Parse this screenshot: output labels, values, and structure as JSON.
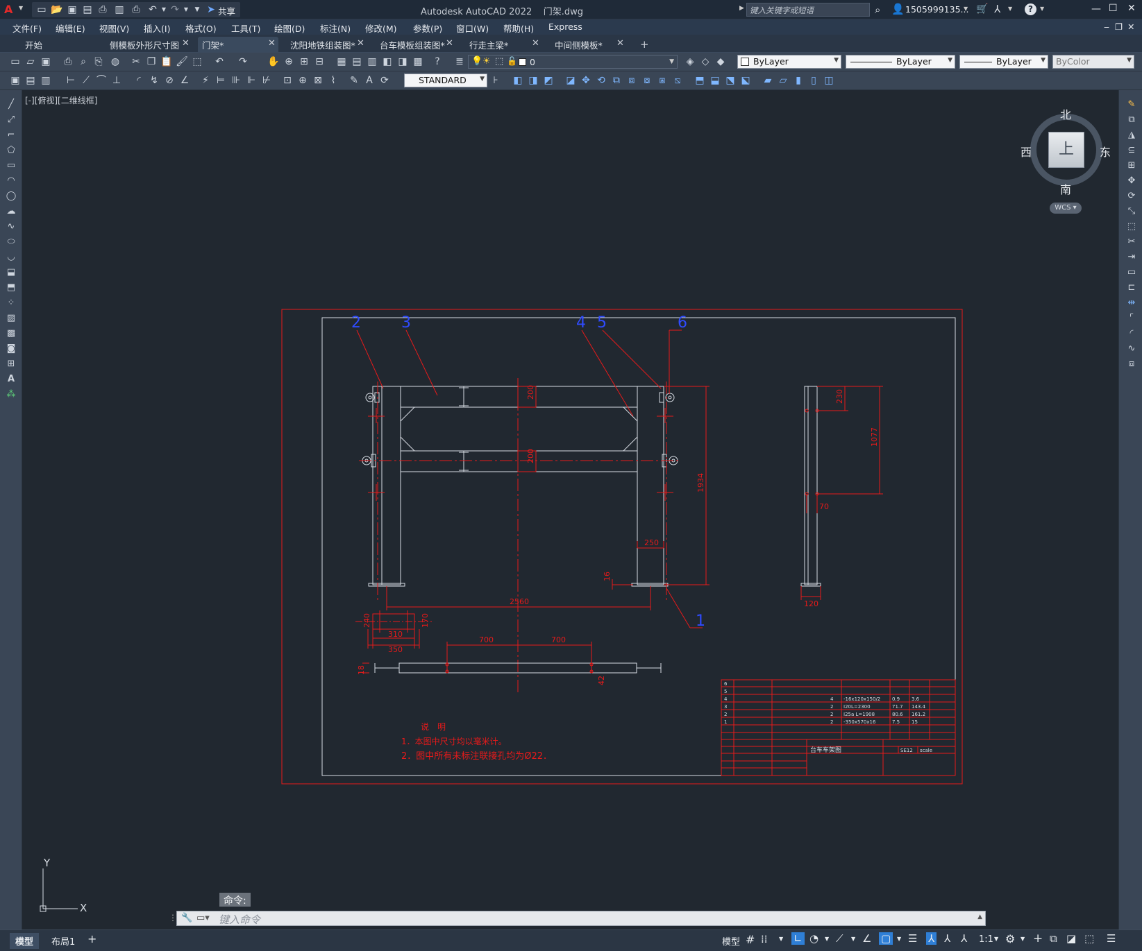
{
  "titlebar": {
    "app_title": "Autodesk AutoCAD 2022",
    "file_name": "门架.dwg",
    "share_label": "共享",
    "search_placeholder": "键入关键字或短语",
    "user_name": "1505999135...",
    "min": "—",
    "max": "☐",
    "close": "✕"
  },
  "menubar": {
    "items": [
      "文件(F)",
      "编辑(E)",
      "视图(V)",
      "插入(I)",
      "格式(O)",
      "工具(T)",
      "绘图(D)",
      "标注(N)",
      "修改(M)",
      "参数(P)",
      "窗口(W)",
      "帮助(H)",
      "Express"
    ]
  },
  "tabs": [
    {
      "label": "开始",
      "active": false,
      "closable": false
    },
    {
      "label": "侧模板外形尺寸图",
      "active": false,
      "closable": true
    },
    {
      "label": "门架*",
      "active": true,
      "closable": true
    },
    {
      "label": "沈阳地铁组装图*",
      "active": false,
      "closable": true
    },
    {
      "label": "台车模板组装图*",
      "active": false,
      "closable": true
    },
    {
      "label": "行走主梁*",
      "active": false,
      "closable": true
    },
    {
      "label": "中间侧模板*",
      "active": false,
      "closable": true
    }
  ],
  "toolbar": {
    "layer_value": "0",
    "color_value": "ByLayer",
    "linetype_value": "ByLayer",
    "lineweight_value": "ByLayer",
    "plotstyle_value": "ByColor",
    "textstyle_value": "STANDARD"
  },
  "viewport": {
    "label": "[-][俯视][二维线框]"
  },
  "viewcube": {
    "north": "北",
    "south": "南",
    "east": "东",
    "west": "西",
    "face": "上",
    "wcs": "WCS"
  },
  "ucs": {
    "x": "X",
    "y": "Y"
  },
  "drawing": {
    "balloons": [
      "1",
      "2",
      "3",
      "4",
      "5",
      "6"
    ],
    "dims_front": {
      "d200a": "200",
      "d200b": "200",
      "d1934": "1934",
      "d250": "250",
      "d16": "16",
      "d2560": "2560"
    },
    "dims_side": {
      "d230": "230",
      "d1077": "1077",
      "d70": "70",
      "d120": "120"
    },
    "dims_detail": {
      "d310": "310",
      "d350": "350",
      "d240": "240",
      "d170": "170"
    },
    "dims_bottom": {
      "d700a": "700",
      "d700b": "700",
      "d18": "18",
      "d42": "42"
    },
    "notes_title": "说　明",
    "notes": [
      "1．本图中尺寸均以毫米计。",
      "2．图中所有未标注联接孔均为Ø22．"
    ],
    "bom_rows": [
      {
        "no": "6",
        "name": "",
        "qty": "",
        "spec": "",
        "unit": "",
        "total": ""
      },
      {
        "no": "5",
        "name": "",
        "qty": "",
        "spec": "",
        "unit": "",
        "total": ""
      },
      {
        "no": "4",
        "name": "",
        "qty": "4",
        "spec": "-16x120x150/2",
        "unit": "0.9",
        "total": "3.6"
      },
      {
        "no": "3",
        "name": "",
        "qty": "2",
        "spec": "I20L=2300",
        "unit": "71.7",
        "total": "143.4"
      },
      {
        "no": "2",
        "name": "",
        "qty": "2",
        "spec": "I25a L=1908",
        "unit": "80.6",
        "total": "161.2"
      },
      {
        "no": "1",
        "name": "",
        "qty": "2",
        "spec": "-350x570x16",
        "unit": "7.5",
        "total": "15"
      }
    ],
    "title_block_name": "台车车架图",
    "title_block_fields": [
      "",
      "",
      "",
      "SE12",
      "scale"
    ]
  },
  "command": {
    "history_label": "命令:",
    "input_placeholder": "键入命令"
  },
  "layout_tabs": [
    "模型",
    "布局1"
  ],
  "status": {
    "model": "模型",
    "scale": "1:1"
  },
  "colors": {
    "canvas_bg": "#212830",
    "drawing_red": "#e81a1a",
    "geometry_white": "#d8dde4",
    "balloon_blue": "#2f4bff",
    "toolbar_bg": "#3a4656"
  }
}
